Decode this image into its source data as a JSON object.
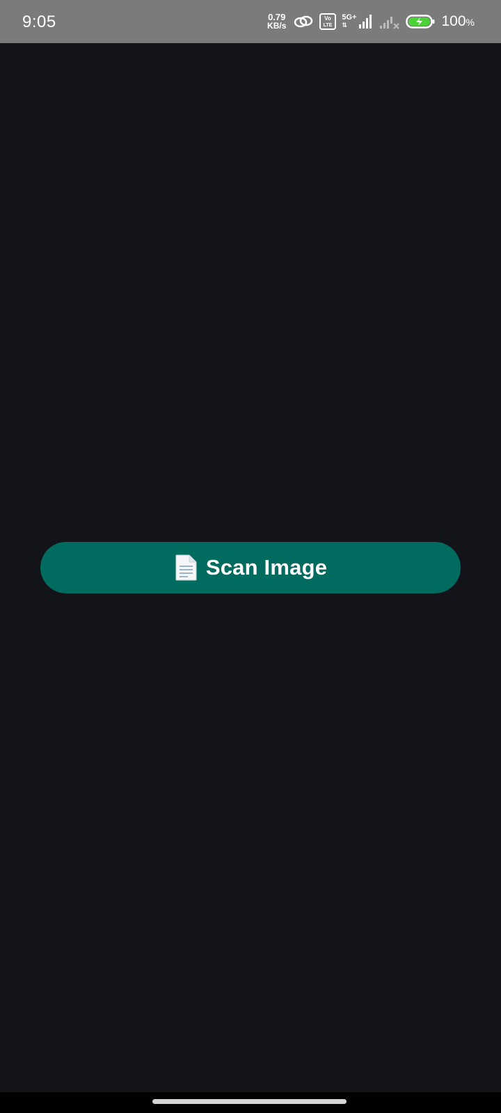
{
  "status_bar": {
    "time": "9:05",
    "net_speed_value": "0.79",
    "net_speed_unit": "KB/s",
    "volte_label_top": "Vo",
    "volte_label_bottom": "LTE",
    "network_type": "5G+",
    "battery_level": "100",
    "battery_unit": "%",
    "icons": [
      "link-icon",
      "volte-icon",
      "signal-5g-icon",
      "signal-no-service-icon",
      "battery-charging-icon"
    ]
  },
  "main": {
    "scan_button": {
      "icon": "document-icon",
      "label": "Scan Image"
    }
  },
  "colors": {
    "background": "#131419",
    "status_bar": "#7b7b7b",
    "button": "#006b5e",
    "battery_fill": "#4cd137",
    "nav_bar": "#000000",
    "home_handle": "#d4d4d4"
  }
}
